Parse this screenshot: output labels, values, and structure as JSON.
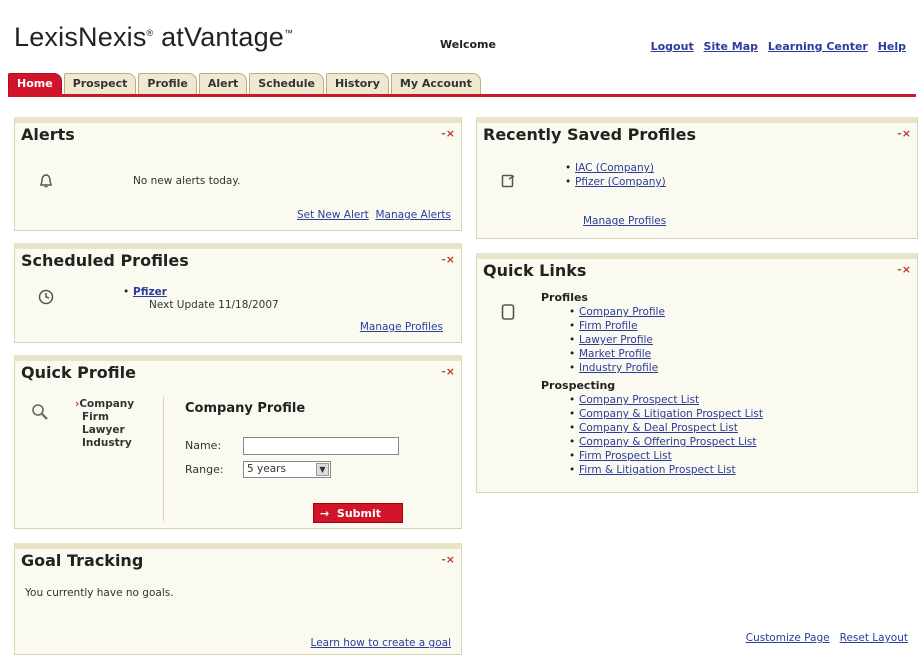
{
  "header": {
    "logo_main": "LexisNexis",
    "logo_sub": "atVantage",
    "welcome": "Welcome",
    "links": [
      "Logout",
      "Site Map",
      "Learning Center",
      "Help"
    ]
  },
  "tabs": [
    {
      "label": "Home",
      "active": true
    },
    {
      "label": "Prospect"
    },
    {
      "label": "Profile"
    },
    {
      "label": "Alert"
    },
    {
      "label": "Schedule"
    },
    {
      "label": "History"
    },
    {
      "label": "My Account"
    }
  ],
  "panel_controls": "-",
  "panel_close": "×",
  "alerts": {
    "title": "Alerts",
    "message": "No new alerts today.",
    "link_set": "Set New Alert",
    "link_manage": "Manage Alerts"
  },
  "scheduled": {
    "title": "Scheduled Profiles",
    "item_name": "Pfizer",
    "item_update": "Next Update 11/18/2007",
    "link_manage": "Manage Profiles"
  },
  "quick_profile": {
    "title": "Quick Profile",
    "types": [
      "Company",
      "Firm",
      "Lawyer",
      "Industry"
    ],
    "form_title": "Company Profile",
    "name_label": "Name:",
    "name_value": "",
    "range_label": "Range:",
    "range_value": "5 years",
    "submit_label": "Submit"
  },
  "goal_tracking": {
    "title": "Goal Tracking",
    "message": "You currently have no goals.",
    "link": "Learn how to create a goal"
  },
  "recent_profiles": {
    "title": "Recently Saved Profiles",
    "items": [
      "IAC (Company)",
      "Pfizer (Company)"
    ],
    "link_manage": "Manage Profiles"
  },
  "quick_links": {
    "title": "Quick Links",
    "profiles_heading": "Profiles",
    "profiles": [
      "Company Profile",
      "Firm Profile",
      "Lawyer Profile",
      "Market Profile",
      "Industry Profile"
    ],
    "prospecting_heading": "Prospecting",
    "prospecting": [
      "Company Prospect List",
      "Company & Litigation Prospect List",
      "Company & Deal Prospect List",
      "Company & Offering Prospect List",
      "Firm Prospect List",
      "Firm & Litigation Prospect List"
    ]
  },
  "footer": {
    "customize": "Customize Page",
    "reset": "Reset Layout"
  }
}
